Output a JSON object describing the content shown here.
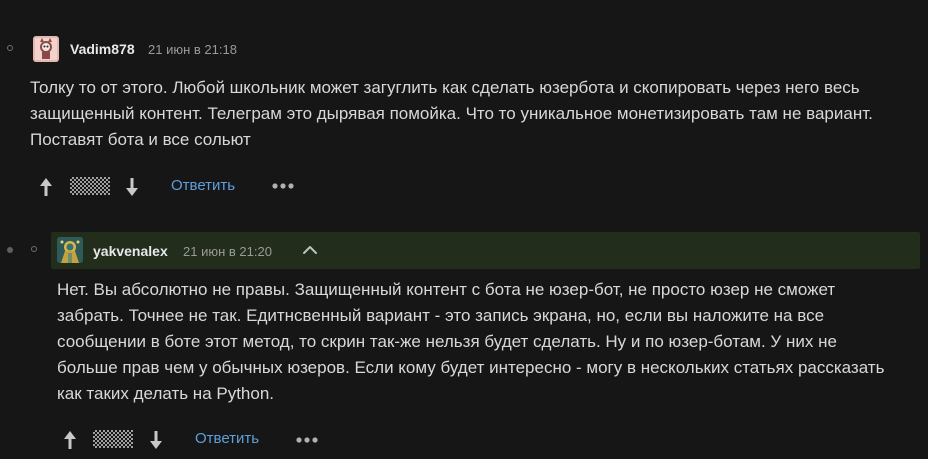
{
  "comments": [
    {
      "username": "Vadim878",
      "timestamp": "21 июн в 21:18",
      "body": "Толку то от этого. Любой школьник может загуглить как сделать юзербота и скопировать через него весь защищенный контент. Телеграм это дырявая помойка. Что то уникальное монетизировать там не вариант. Поставят бота и все сольют",
      "reply_label": "Ответить",
      "avatar_icon": "cat-avatar-icon",
      "highlighted": false
    },
    {
      "username": "yakvenalex",
      "timestamp": "21 июн в 21:20",
      "body": "Нет. Вы абсолютно не правы. Защищенный контент с бота не юзер-бот, не просто юзер не сможет забрать. Точнее не так. Едитнсвенный вариант - это запись экрана, но, если вы наложите на все сообщении в боте этот метод, то скрин так-же нельзя будет сделать. Ну и по юзер-ботам. У них не больше прав чем у обычных юзеров. Если кому будет интересно - могу в нескольких статьях рассказать как таких делать на Python.",
      "reply_label": "Ответить",
      "avatar_icon": "mystic-avatar-icon",
      "highlighted": true
    }
  ],
  "colors": {
    "background": "#161616",
    "highlight": "#222d1c",
    "link": "#5ea0dc",
    "text": "#d8d8d8",
    "muted": "#9a9a9a"
  },
  "icons": {
    "upvote": "arrow-up-icon",
    "downvote": "arrow-down-icon",
    "score_hidden": "hidden-score-icon",
    "more": "more-dots-icon",
    "collapse": "chevron-up-icon"
  }
}
